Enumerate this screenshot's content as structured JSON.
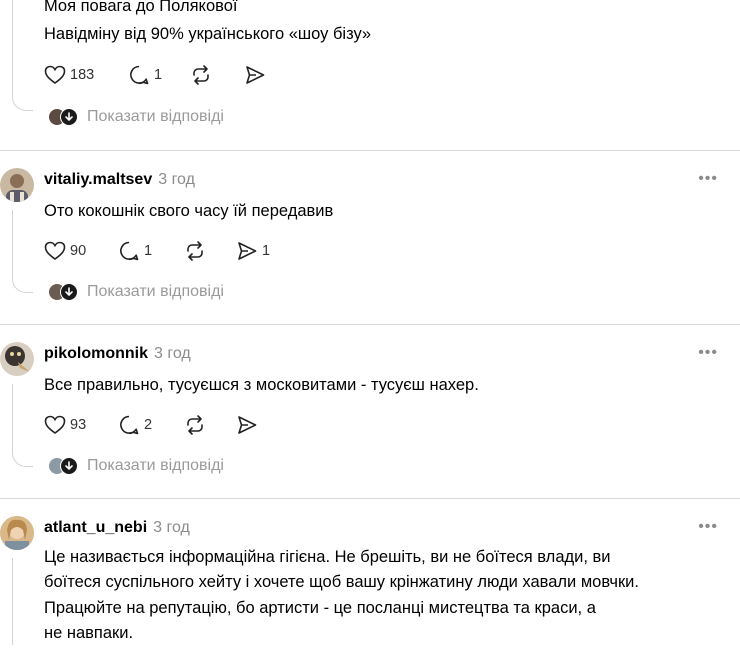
{
  "posts": [
    {
      "id": "p0",
      "username": "",
      "time": "",
      "lines": [
        "Моя повага до Полякової",
        "Навідміну від 90% українського «шоу бізу»"
      ],
      "likes": "183",
      "replies_count": "1",
      "shares": "",
      "show_replies_label": "Показати відповіді"
    },
    {
      "id": "p1",
      "username": "vitaliy.maltsev",
      "time": "3 год",
      "lines": [
        "Ото кокошнік свого часу їй передавив"
      ],
      "likes": "90",
      "replies_count": "1",
      "shares": "1",
      "show_replies_label": "Показати відповіді"
    },
    {
      "id": "p2",
      "username": "pikolomonnik",
      "time": "3 год",
      "lines": [
        "Все правильно, тусуєшся з московитами - тусуєш нахер."
      ],
      "likes": "93",
      "replies_count": "2",
      "shares": "",
      "show_replies_label": "Показати відповіді"
    },
    {
      "id": "p3",
      "username": "atlant_u_nebi",
      "time": "3 год",
      "lines": [
        "Це називається інформаційна гігієна. Не брешіть, ви не боїтеся влади, ви",
        "боїтеся суспільного хейту і хочете щоб вашу крінжатину люди хавали мовчки.",
        "Працюйте на репутацію, бо артисти - це посланці мистецтва та краси, а",
        "не навпаки."
      ]
    }
  ],
  "more_label": "•••",
  "icons": {
    "like": "heart-icon",
    "comment": "comment-icon",
    "repost": "repost-icon",
    "share": "send-icon"
  }
}
